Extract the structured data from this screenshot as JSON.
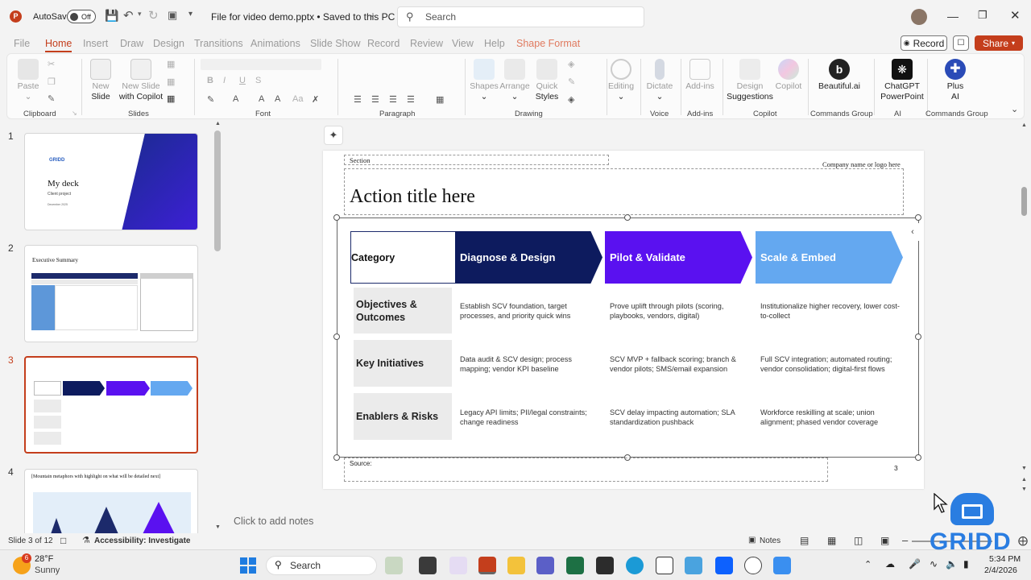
{
  "titlebar": {
    "autosave_label": "AutoSave",
    "autosave_state": "Off",
    "doc_title": "File for video demo.pptx • Saved to this PC",
    "search_placeholder": "Search"
  },
  "tabs": [
    "File",
    "Home",
    "Insert",
    "Draw",
    "Design",
    "Transitions",
    "Animations",
    "Slide Show",
    "Record",
    "Review",
    "View",
    "Help",
    "Shape Format"
  ],
  "actions": {
    "record": "Record",
    "share": "Share"
  },
  "ribbon": {
    "paste": "Paste",
    "new_slide": [
      "New",
      "Slide"
    ],
    "new_slide_copilot": [
      "New Slide",
      "with Copilot"
    ],
    "shapes": "Shapes",
    "arrange": "Arrange",
    "quick_styles": [
      "Quick",
      "Styles"
    ],
    "editing": "Editing",
    "dictate": "Dictate",
    "addins": "Add-ins",
    "design_suggestions": [
      "Design",
      "Suggestions"
    ],
    "copilot": "Copilot",
    "beautiful_ai": "Beautiful.ai",
    "chatgpt_pp": [
      "ChatGPT",
      "PowerPoint"
    ],
    "plus_ai": [
      "Plus",
      "AI"
    ],
    "groups": {
      "clipboard": "Clipboard",
      "slides": "Slides",
      "font": "Font",
      "paragraph": "Paragraph",
      "drawing": "Drawing",
      "voice": "Voice",
      "addins": "Add-ins",
      "copilot": "Copilot",
      "commands1": "Commands Group",
      "ai": "AI",
      "commands2": "Commands Group"
    }
  },
  "thumbnails": [
    {
      "num": "1",
      "title": "My deck",
      "subtitle": "Client project",
      "date": "December 2025",
      "brand": "GRIDD"
    },
    {
      "num": "2",
      "title": "Executive Summary"
    },
    {
      "num": "3"
    },
    {
      "num": "4",
      "title": "[Mountain metaphors with highlight on what will be detailed next]"
    }
  ],
  "slide": {
    "section": "Section",
    "company": "Company name or logo here",
    "title": "Action title here",
    "category": "Category",
    "phases": [
      "Diagnose & Design",
      "Pilot & Validate",
      "Scale & Embed"
    ],
    "phase_colors": [
      "#0d1b5e",
      "#5a11f0",
      "#64a8f0"
    ],
    "rows": [
      {
        "label": "Objectives & Outcomes",
        "cells": [
          "Establish SCV foundation, target processes, and priority quick wins",
          "Prove uplift through pilots (scoring, playbooks, vendors, digital)",
          "Institutionalize higher recovery, lower cost-to-collect"
        ]
      },
      {
        "label": "Key Initiatives",
        "cells": [
          "Data audit & SCV design; process mapping; vendor KPI baseline",
          "SCV MVP + fallback scoring; branch & vendor pilots; SMS/email expansion",
          "Full SCV integration; automated routing; vendor consolidation; digital-first flows"
        ]
      },
      {
        "label": "Enablers & Risks",
        "cells": [
          "Legacy API limits; PII/legal constraints; change readiness",
          "SCV delay impacting automation; SLA standardization pushback",
          "Workforce reskilling at scale; union alignment; phased vendor coverage"
        ]
      }
    ],
    "source": "Source:",
    "page_num": "3"
  },
  "notes_placeholder": "Click to add notes",
  "status": {
    "slide_info": "Slide 3 of 12",
    "accessibility": "Accessibility: Investigate",
    "notes": "Notes"
  },
  "taskbar": {
    "temp": "28°F",
    "weather": "Sunny",
    "search": "Search",
    "time": "5:34 PM",
    "date": "2/4/2026",
    "badge": "6"
  },
  "watermark": "GRIDD",
  "colors": {
    "accent": "#c43e1c",
    "navy": "#0d1b5e",
    "purple": "#5a11f0",
    "sky": "#64a8f0"
  }
}
